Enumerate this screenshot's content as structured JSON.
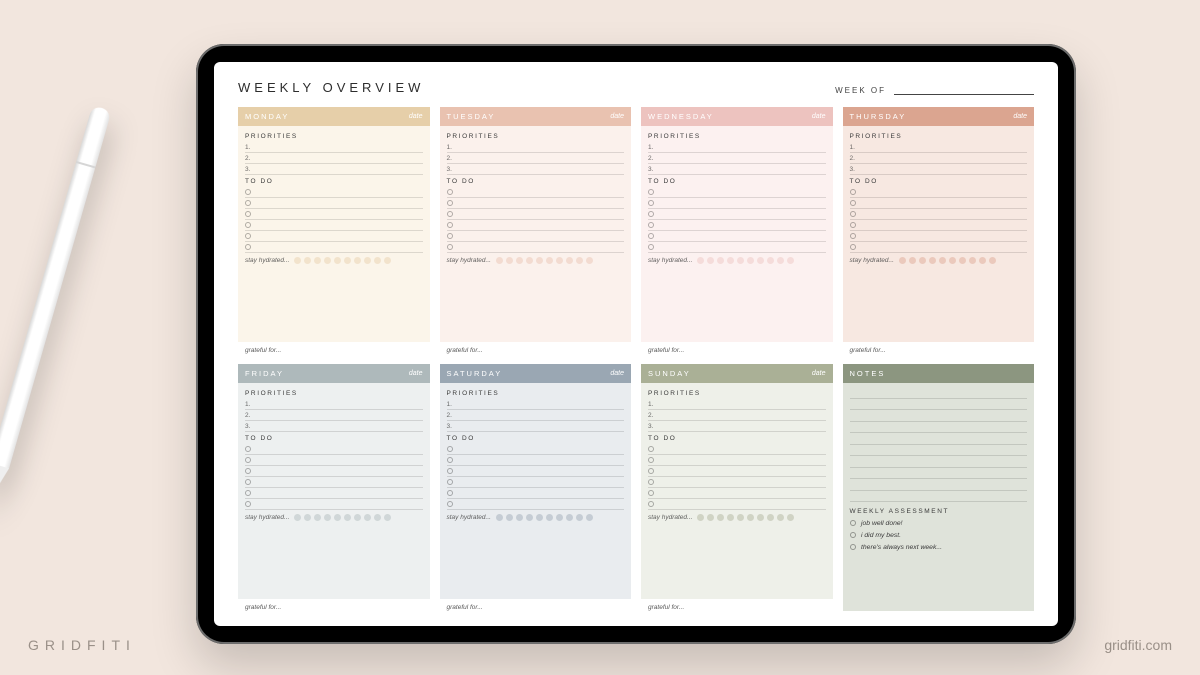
{
  "watermark": {
    "brand": "GRIDFITI",
    "url": "gridfiti.com"
  },
  "header": {
    "title": "WEEKLY OVERVIEW",
    "week_of": "WEEK OF"
  },
  "labels": {
    "priorities": "PRIORITIES",
    "todo": "TO DO",
    "date": "date",
    "hydrate": "stay hydrated...",
    "grateful": "grateful for...",
    "notes_head": "NOTES",
    "assessment": "WEEKLY ASSESSMENT"
  },
  "priority_nums": [
    "1.",
    "2.",
    "3."
  ],
  "days": [
    {
      "name": "MONDAY",
      "head": "#e6cfa9",
      "body": "#fbf5ea",
      "dot": "#e6cfa9"
    },
    {
      "name": "TUESDAY",
      "head": "#e9c2b0",
      "body": "#fbf1ec",
      "dot": "#e9c2b0"
    },
    {
      "name": "WEDNESDAY",
      "head": "#edc3bf",
      "body": "#fcf1f0",
      "dot": "#edc3bf"
    },
    {
      "name": "THURSDAY",
      "head": "#dba590",
      "body": "#f7e8e1",
      "dot": "#dba590"
    },
    {
      "name": "FRIDAY",
      "head": "#aeb9bb",
      "body": "#edf0f0",
      "dot": "#aeb9bb"
    },
    {
      "name": "SATURDAY",
      "head": "#9aa7b3",
      "body": "#e9ecef",
      "dot": "#9aa7b3"
    },
    {
      "name": "SUNDAY",
      "head": "#aab096",
      "body": "#eef0e9",
      "dot": "#aab096"
    }
  ],
  "notes": {
    "head": "#8c9680",
    "body": "#dfe3da"
  },
  "assessment_items": [
    "job well done!",
    "i did my best.",
    "there's always next week..."
  ]
}
